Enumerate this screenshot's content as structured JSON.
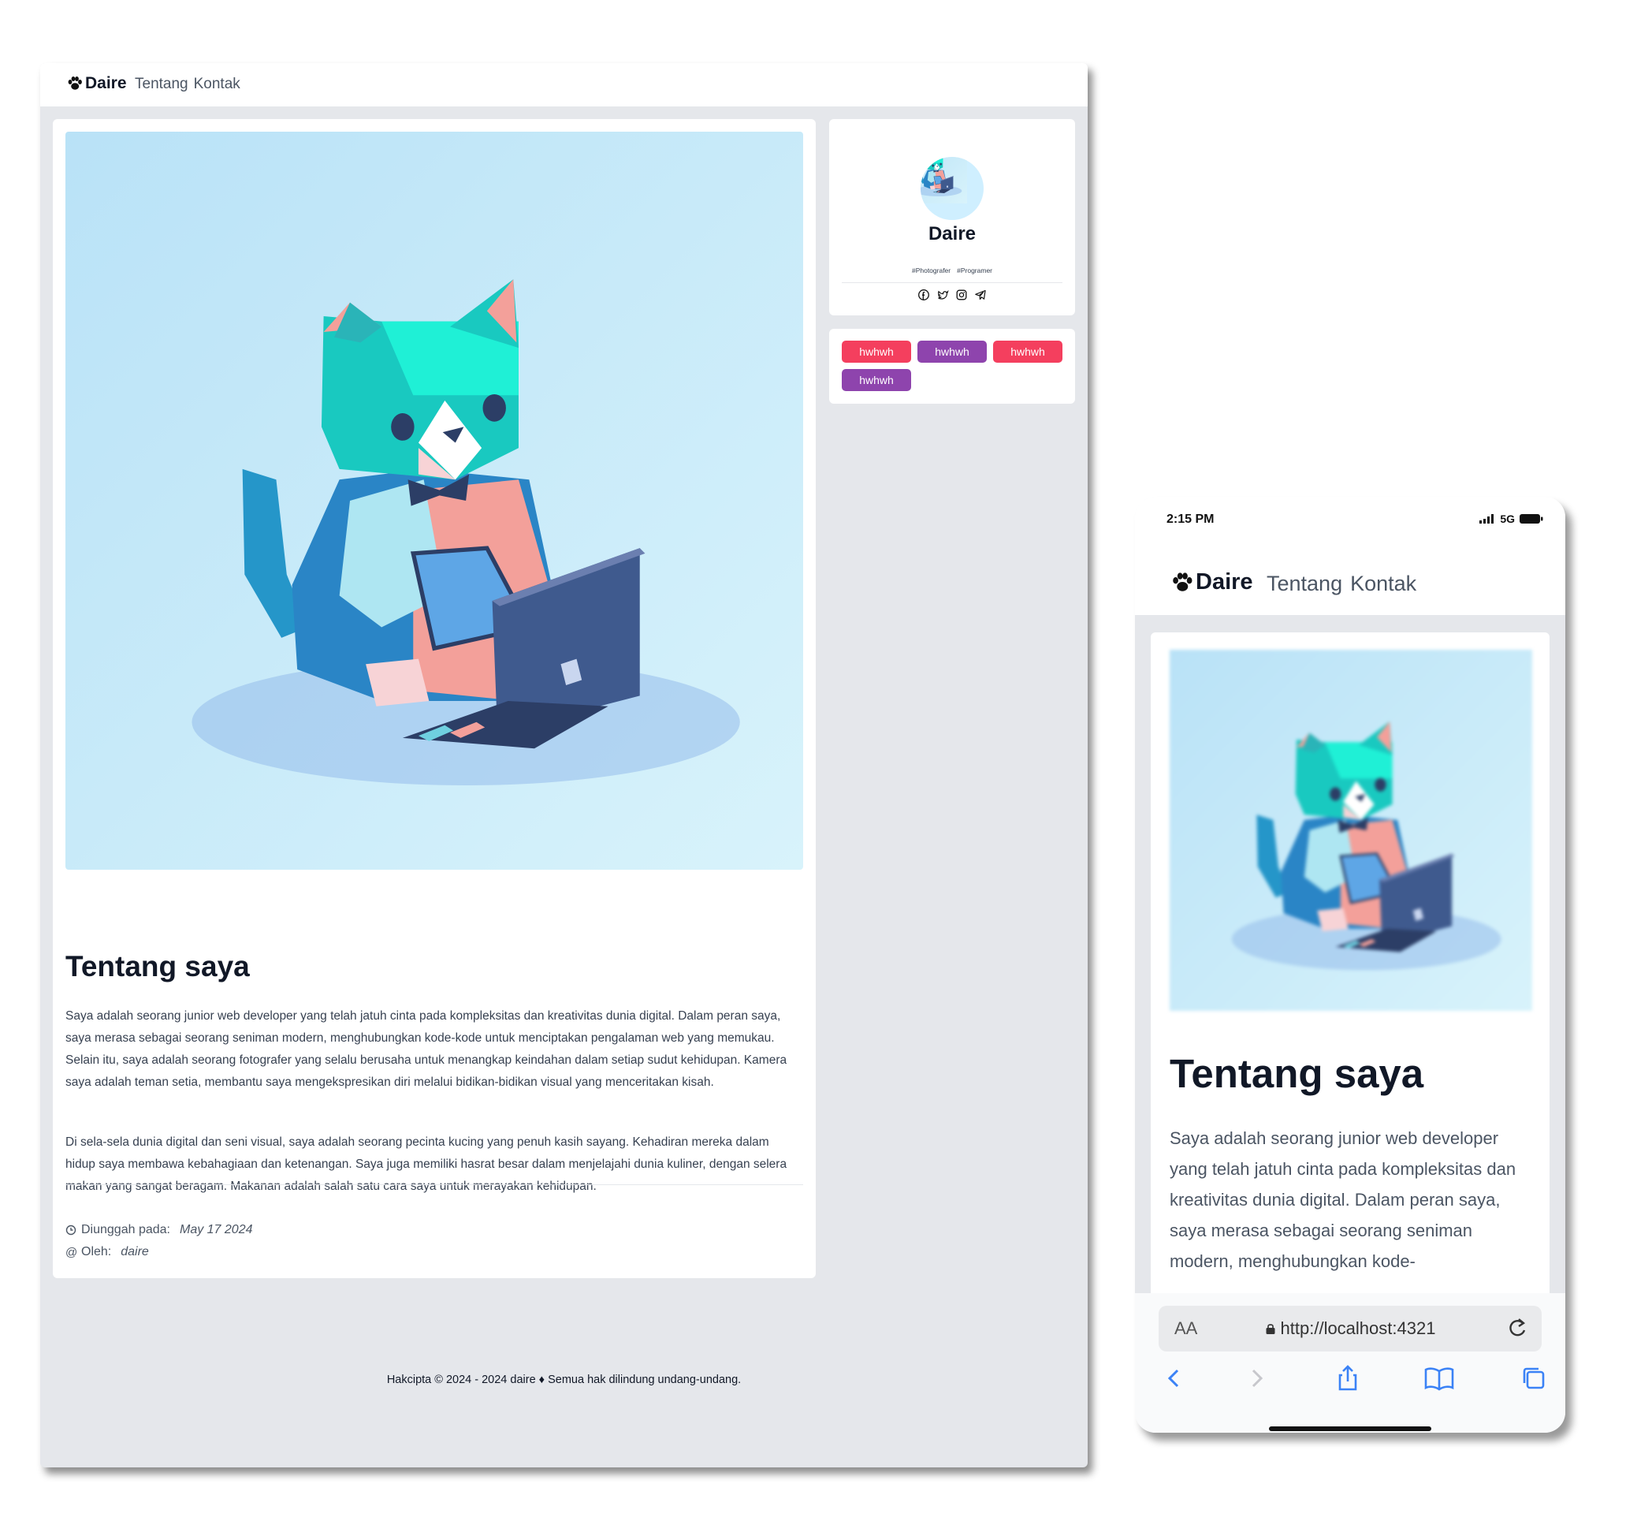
{
  "site": {
    "brand": "Daire",
    "nav": [
      "Tentang",
      "Kontak"
    ]
  },
  "about": {
    "title": "Tentang saya",
    "paragraphs": [
      "Saya adalah seorang junior web developer yang telah jatuh cinta pada kompleksitas dan kreativitas dunia digital. Dalam peran saya, saya merasa sebagai seorang seniman modern, menghubungkan kode-kode untuk menciptakan pengalaman web yang memukau. Selain itu, saya adalah seorang fotografer yang selalu berusaha untuk menangkap keindahan dalam setiap sudut kehidupan. Kamera saya adalah teman setia, membantu saya mengekspresikan diri melalui bidikan-bidikan visual yang menceritakan kisah.",
      "Di sela-sela dunia digital dan seni visual, saya adalah seorang pecinta kucing yang penuh kasih sayang. Kehadiran mereka dalam hidup saya membawa kebahagiaan dan ketenangan. Saya juga memiliki hasrat besar dalam menjelajahi dunia kuliner, dengan selera makan yang sangat beragam. Makanan adalah salah satu cara saya untuk merayakan kehidupan."
    ],
    "uploaded_label": "Diunggah pada:",
    "uploaded_value": "May 17 2024",
    "author_label": "Oleh:",
    "author_value": "daire"
  },
  "profile": {
    "name": "Daire",
    "hashtags": [
      "#Photografer",
      "#Programer"
    ],
    "social_icons": [
      "facebook-icon",
      "twitter-icon",
      "instagram-icon",
      "telegram-icon"
    ]
  },
  "tags": [
    {
      "label": "hwhwh",
      "color": "#f43f5e"
    },
    {
      "label": "hwhwh",
      "color": "#8e44ad"
    },
    {
      "label": "hwhwh",
      "color": "#f43f5e"
    },
    {
      "label": "hwhwh",
      "color": "#8e44ad"
    }
  ],
  "footer": "Hakcipta © 2024 - 2024 daire ♦ Semua hak dilindung undang-undang.",
  "phone": {
    "time": "2:15 PM",
    "network": "5G",
    "brand": "Daire",
    "nav": [
      "Tentang",
      "Kontak"
    ],
    "title": "Tentang saya",
    "paragraph": "Saya adalah seorang junior web developer yang telah jatuh cinta pada kompleksitas dan kreativitas dunia digital. Dalam peran saya, saya merasa sebagai seorang seniman modern, menghubungkan kode-",
    "text_size_label": "AA",
    "url": "http://localhost:4321"
  }
}
